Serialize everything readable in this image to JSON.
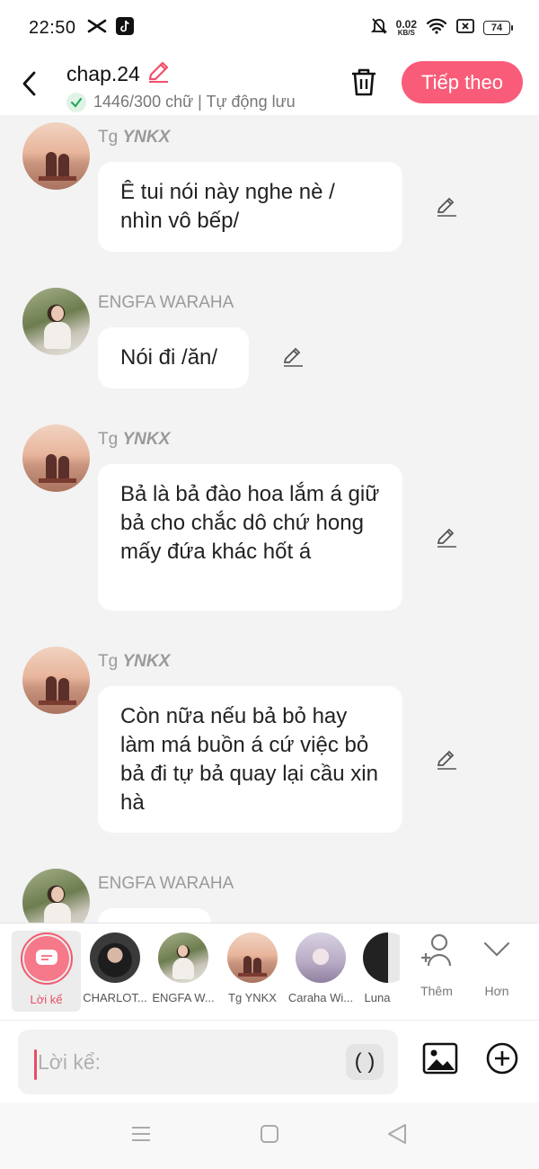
{
  "status_bar": {
    "time": "22:50",
    "net_speed_value": "0.02",
    "net_speed_unit": "KB/S",
    "battery": "74",
    "icons": [
      "capcut-icon",
      "tiktok-icon",
      "mute-bell-icon",
      "wifi-icon",
      "sim-x-icon",
      "battery-icon"
    ]
  },
  "header": {
    "title": "chap.24",
    "word_count": "1446/300 chữ | Tự động lưu",
    "next_label": "Tiếp theo",
    "accent_color": "#f95c78"
  },
  "messages": [
    {
      "sender_prefix": "Tg",
      "sender_name": "YNKX",
      "text": "Ê tui nói này nghe nè / nhìn vô bếp/",
      "avatar": "sunset-couple"
    },
    {
      "sender_prefix": "",
      "sender_name": "ENGFA WARAHA",
      "text": "Nói đi /ăn/",
      "avatar": "engfa"
    },
    {
      "sender_prefix": "Tg",
      "sender_name": "YNKX",
      "text": "Bả là bả đào hoa lắm á giữ bả cho chắc dô chứ hong mấy đứa khác hốt á",
      "avatar": "sunset-couple"
    },
    {
      "sender_prefix": "Tg",
      "sender_name": "YNKX",
      "text": "Còn nữa nếu bả bỏ hay làm má buồn á cứ việc bỏ bả đi tự bả quay lại cầu xin hà",
      "avatar": "sunset-couple"
    },
    {
      "sender_prefix": "",
      "sender_name": "ENGFA WARAHA",
      "text": "",
      "avatar": "engfa"
    }
  ],
  "characters": {
    "narrator": "Lời kể",
    "list": [
      "CHARLOT...",
      "ENGFA W...",
      "Tg YNKX",
      "Caraha Wi...",
      "Luna"
    ],
    "add_label": "Thêm",
    "more_label": "Hơn"
  },
  "input": {
    "placeholder": "Lời kể:",
    "paren_label": "( )"
  }
}
